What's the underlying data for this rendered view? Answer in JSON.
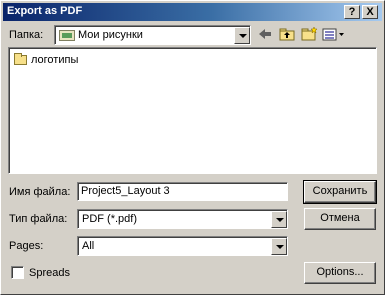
{
  "window": {
    "title": "Export as PDF"
  },
  "titlebar": {
    "help_label": "?",
    "close_label": "X"
  },
  "folder_row": {
    "label": "Папка:",
    "value": "Мои рисунки"
  },
  "file_list": {
    "items": [
      "логотипы"
    ]
  },
  "filename": {
    "label": "Имя файла:",
    "value": "Project5_Layout 3"
  },
  "filetype": {
    "label": "Тип файла:",
    "value": "PDF (*.pdf)"
  },
  "pages": {
    "label": "Pages:",
    "value": "All"
  },
  "spreads": {
    "label": "Spreads",
    "checked": false
  },
  "buttons": {
    "save": "Сохранить",
    "cancel": "Отмена",
    "options": "Options..."
  }
}
